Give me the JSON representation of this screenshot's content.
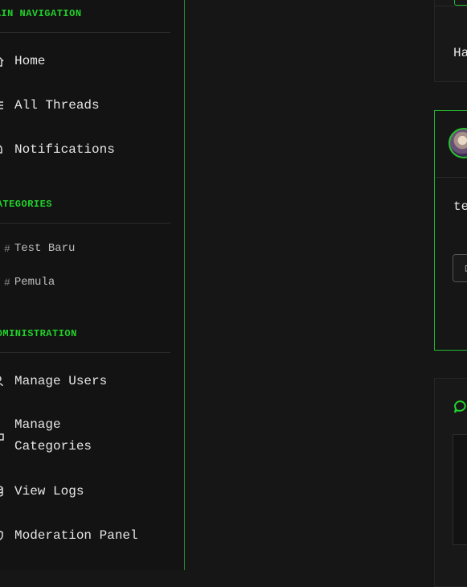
{
  "sidebar": {
    "main_title": "MAIN NAVIGATION",
    "main_items": [
      {
        "label": "Home",
        "icon": "home-icon"
      },
      {
        "label": "All Threads",
        "icon": "list-icon"
      },
      {
        "label": "Notifications",
        "icon": "bell-icon"
      }
    ],
    "categories_title": "CATEGORIES",
    "categories": [
      {
        "label": "Test Baru"
      },
      {
        "label": "Pemula"
      }
    ],
    "admin_title": "ADMINISTRATION",
    "admin_items": [
      {
        "label": "Manage Users",
        "icon": "users-icon"
      },
      {
        "label": "Manage Categories",
        "icon": "folder-icon"
      },
      {
        "label": "View Logs",
        "icon": "database-icon"
      },
      {
        "label": "Moderation Panel",
        "icon": "shield-icon"
      }
    ]
  },
  "main": {
    "card1_text": "Ha",
    "card2_text": "te"
  },
  "colors": {
    "accent": "#22d12a",
    "background": "#161616",
    "sidebar": "#131313"
  }
}
